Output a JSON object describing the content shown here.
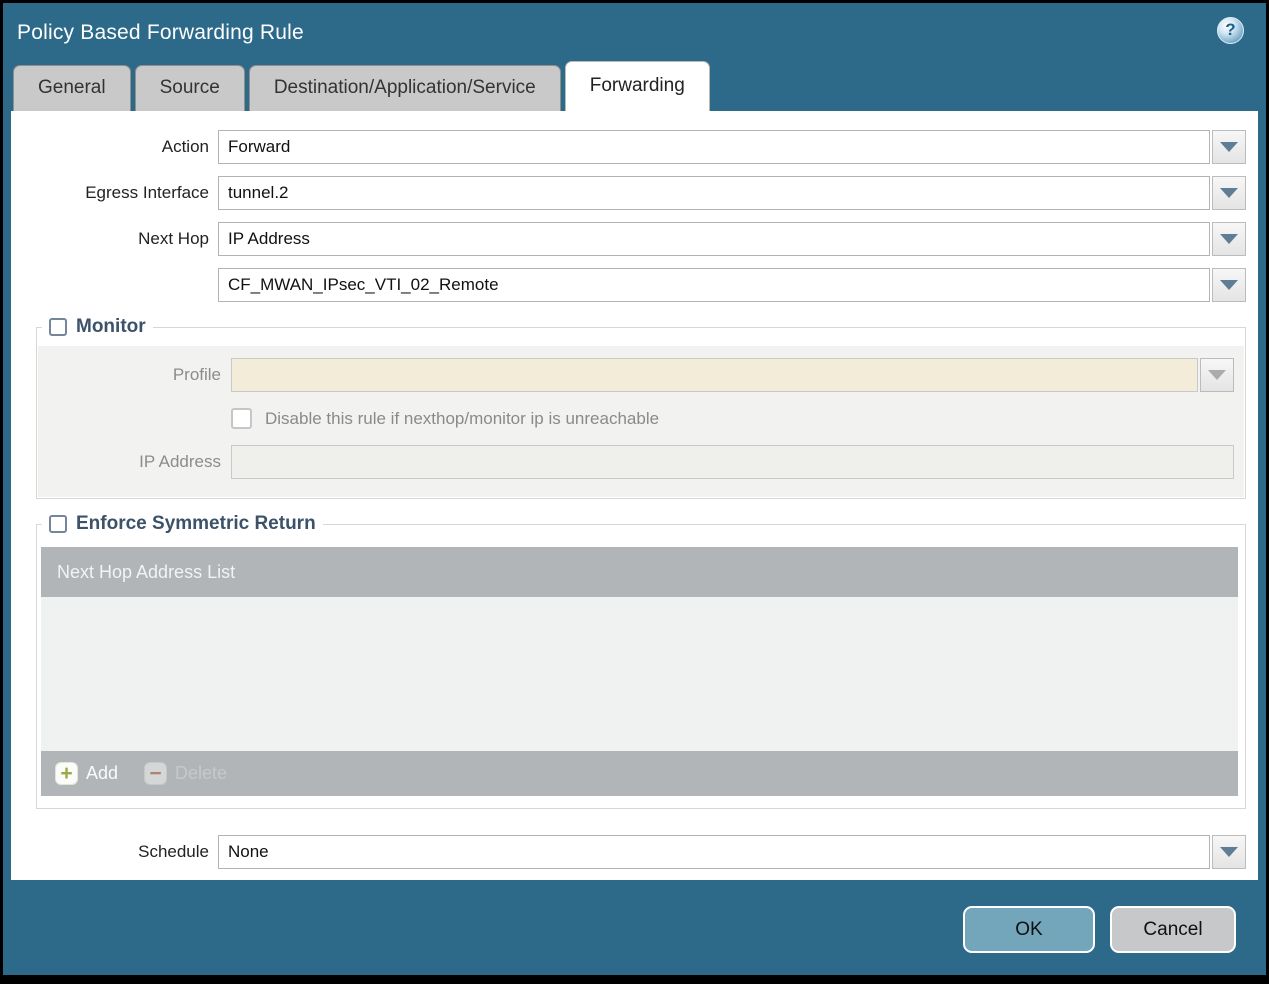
{
  "window": {
    "title": "Policy Based Forwarding Rule"
  },
  "icons": {
    "help": "?",
    "dropdown": "chevron-down",
    "add": "+",
    "delete": "−"
  },
  "tabs": [
    {
      "label": "General",
      "active": false
    },
    {
      "label": "Source",
      "active": false
    },
    {
      "label": "Destination/Application/Service",
      "active": false
    },
    {
      "label": "Forwarding",
      "active": true
    }
  ],
  "form": {
    "action": {
      "label": "Action",
      "value": "Forward"
    },
    "egress_interface": {
      "label": "Egress Interface",
      "value": "tunnel.2"
    },
    "next_hop": {
      "label": "Next Hop",
      "value": "IP Address"
    },
    "next_hop_address": {
      "value": "CF_MWAN_IPsec_VTI_02_Remote"
    },
    "schedule": {
      "label": "Schedule",
      "value": "None"
    }
  },
  "monitor": {
    "legend": "Monitor",
    "checked": false,
    "profile": {
      "label": "Profile",
      "value": ""
    },
    "disable_rule": {
      "label": "Disable this rule if nexthop/monitor ip is unreachable",
      "checked": false
    },
    "ip_address": {
      "label": "IP Address",
      "value": ""
    }
  },
  "symmetric_return": {
    "legend": "Enforce Symmetric Return",
    "checked": false,
    "table": {
      "header": "Next Hop Address List",
      "rows": []
    },
    "add_label": "Add",
    "delete_label": "Delete"
  },
  "footer": {
    "ok_label": "OK",
    "cancel_label": "Cancel"
  },
  "colors": {
    "titlebar_background": "#2d6a8a",
    "active_tab_background": "#ffffff",
    "inactive_tab_background": "#c9c9c9",
    "legend_text": "#3c5268",
    "profile_field_background": "#f2ecd9",
    "table_header_background": "#b1b5b7",
    "ok_button_background": "#73a6bb",
    "cancel_button_background": "#c6c8ca",
    "dropdown_arrow": "#5f7e96",
    "add_icon_color": "#9aa845",
    "delete_icon_color": "#b08077"
  }
}
